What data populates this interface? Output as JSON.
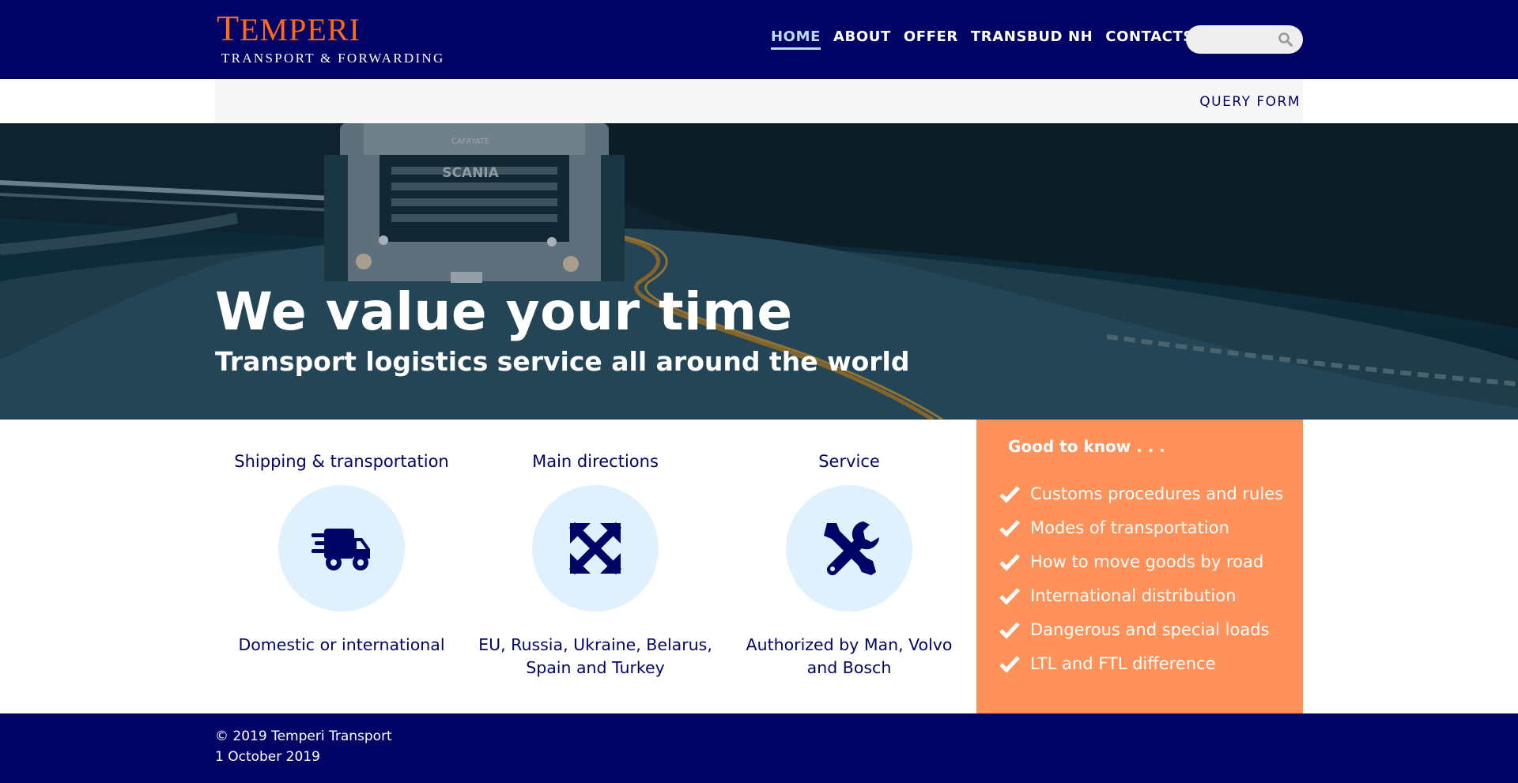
{
  "colors": {
    "navy": "#020465",
    "brand_orange": "#ff6a1a",
    "panel_orange": "#ff925a",
    "circle_bg": "#dff1fd",
    "nav_active": "#bcdcff"
  },
  "header": {
    "logo_first": "T",
    "logo_rest": "EMPERI",
    "tagline": "TRANSPORT & FORWARDING",
    "nav": [
      "HOME",
      "ABOUT",
      "OFFER",
      "TRANSBUD NH",
      "CONTACTS"
    ],
    "active_nav": "HOME",
    "search_placeholder": "",
    "search_icon": "search-icon"
  },
  "subnav": {
    "query_form": "QUERY FORM"
  },
  "hero": {
    "title": "We value your time",
    "subtitle": "Transport logistics service all around the world",
    "truck_brand": "SCANIA",
    "truck_sign": "CAFAYATE"
  },
  "features": [
    {
      "title": "Shipping & transportation",
      "icon": "truck-icon",
      "description": "Domestic or international"
    },
    {
      "title": "Main directions",
      "icon": "expand-arrows-icon",
      "description": "EU, Russia, Ukraine, Belarus, Spain and Turkey"
    },
    {
      "title": "Service",
      "icon": "tools-icon",
      "description": "Authorized by Man, Volvo and Bosch"
    }
  ],
  "good_to_know": {
    "title": "Good to know . . .",
    "items": [
      "Customs procedures and rules",
      "Modes of transportation",
      "How to move goods by road",
      "International distribution",
      "Dangerous and special loads",
      "LTL and FTL difference"
    ]
  },
  "footer": {
    "copyright": "© 2019 Temperi Transport",
    "date": "1 October 2019"
  }
}
